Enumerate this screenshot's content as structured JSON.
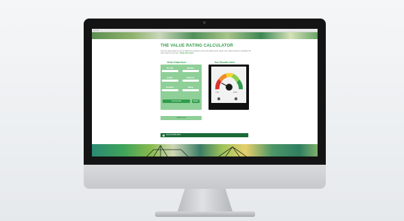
{
  "browser": {
    "url": ""
  },
  "page": {
    "title": "THE VALUE RATING CALCULATOR",
    "intro_lines": [
      "Use the value rating to see the difference between price and performance.",
      "Enter your values below to calculate the value rating of any item.",
      "Show the result"
    ]
  },
  "left_panel": {
    "heading": "Enter Data Here:",
    "fields": [
      {
        "label": "Price ($):",
        "value": ""
      },
      {
        "label": "Quantity:",
        "value": ""
      },
      {
        "label": "Quality:",
        "value": ""
      },
      {
        "label": "Efficiency:",
        "value": ""
      },
      {
        "label": "Durability:",
        "value": ""
      },
      {
        "label": "Rating:",
        "value": ""
      }
    ],
    "calculate_label": "CALCULATE",
    "reset_label": "RESET"
  },
  "right_panel": {
    "heading": "See Results Here:",
    "results": [
      "LOW",
      "HIGH"
    ]
  },
  "learn_more_label": "LEARN MORE",
  "bottom_bar_label": "CALCULATOR INFO",
  "colors": {
    "brand_green": "#2e9b47",
    "light_green": "#8fcf98",
    "dark_green": "#1b6b39"
  }
}
